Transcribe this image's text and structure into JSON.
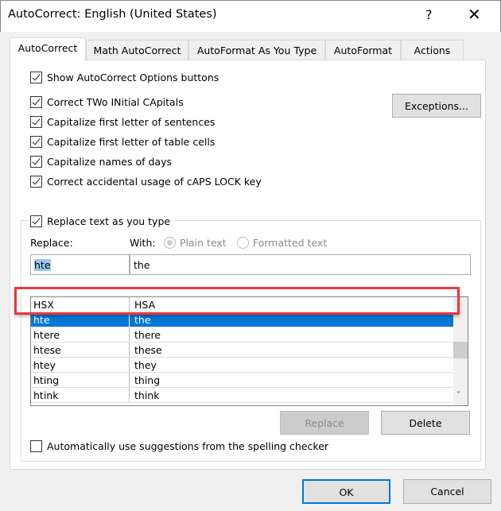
{
  "window": {
    "title": "AutoCorrect: English (United States)",
    "help": "?",
    "close": "✕"
  },
  "tabs": [
    {
      "label": "AutoCorrect"
    },
    {
      "label": "Math AutoCorrect"
    },
    {
      "label": "AutoFormat As You Type"
    },
    {
      "label": "AutoFormat"
    },
    {
      "label": "Actions"
    }
  ],
  "options": [
    {
      "label": "Show AutoCorrect Options buttons",
      "checked": true
    },
    {
      "label": "Correct TWo INitial CApitals",
      "checked": true
    },
    {
      "label": "Capitalize first letter of sentences",
      "checked": true
    },
    {
      "label": "Capitalize first letter of table cells",
      "checked": true
    },
    {
      "label": "Capitalize names of days",
      "checked": true
    },
    {
      "label": "Correct accidental usage of cAPS LOCK key",
      "checked": true
    }
  ],
  "exceptions_label": "Exceptions...",
  "replace_group": {
    "label": "Replace text as you type",
    "checked": true,
    "replace_label": "Replace:",
    "with_label": "With:",
    "plain_text": "Plain text",
    "formatted_text": "Formatted text",
    "replace_value": "hte",
    "with_value": "the"
  },
  "entries": [
    {
      "from": "HSX",
      "to": "HSA"
    },
    {
      "from": "hte",
      "to": "the",
      "selected": true
    },
    {
      "from": "htere",
      "to": "there"
    },
    {
      "from": "htese",
      "to": "these"
    },
    {
      "from": "htey",
      "to": "they"
    },
    {
      "from": "hting",
      "to": "thing"
    },
    {
      "from": "htink",
      "to": "think"
    }
  ],
  "replace_button": "Replace",
  "delete_button": "Delete",
  "spelling_option": {
    "label": "Automatically use suggestions from the spelling checker",
    "checked": false
  },
  "ok": "OK",
  "cancel": "Cancel",
  "colors": {
    "selection": "#0078d7",
    "highlight": "#e8383d"
  }
}
